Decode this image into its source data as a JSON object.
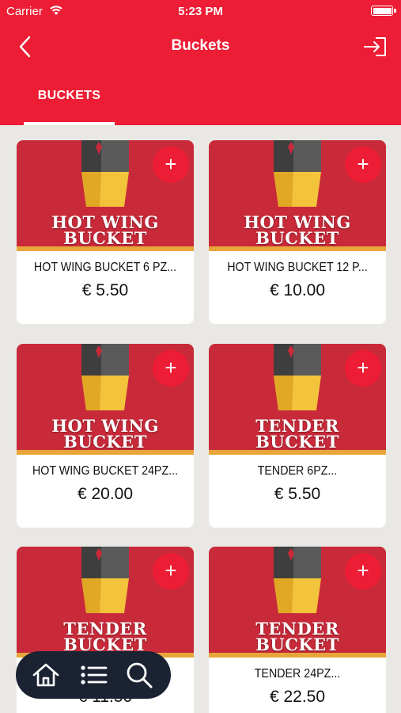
{
  "status_bar": {
    "carrier": "Carrier",
    "time": "5:23 PM"
  },
  "header": {
    "title": "Buckets",
    "back_icon": "chevron-left-icon",
    "logout_icon": "sign-out-icon"
  },
  "tabs": [
    {
      "label": "BUCKETS",
      "active": true
    }
  ],
  "products": [
    {
      "image_line1": "Hot Wing",
      "image_line2": "Bucket",
      "name": "HOT WING BUCKET 6 PZ...",
      "price": "€ 5.50",
      "add": "+"
    },
    {
      "image_line1": "Hot Wing",
      "image_line2": "Bucket",
      "name": "HOT WING BUCKET 12 P...",
      "price": "€ 10.00",
      "add": "+"
    },
    {
      "image_line1": "Hot Wing",
      "image_line2": "Bucket",
      "name": "HOT WING BUCKET 24PZ...",
      "price": "€ 20.00",
      "add": "+"
    },
    {
      "image_line1": "Tender",
      "image_line2": "Bucket",
      "name": "TENDER 6PZ...",
      "price": "€ 5.50",
      "add": "+"
    },
    {
      "image_line1": "Tender",
      "image_line2": "Bucket",
      "name": "",
      "price": "€ 11.50",
      "add": "+"
    },
    {
      "image_line1": "Tender",
      "image_line2": "Bucket",
      "name": "TENDER 24PZ...",
      "price": "€ 22.50",
      "add": "+"
    }
  ],
  "bottom_nav": {
    "items": [
      "home-icon",
      "list-icon",
      "search-icon"
    ]
  },
  "colors": {
    "brand_red": "#ec1d34",
    "image_red": "#c92a3a",
    "nav_dark": "#1b2333",
    "background": "#e9e8e4"
  }
}
